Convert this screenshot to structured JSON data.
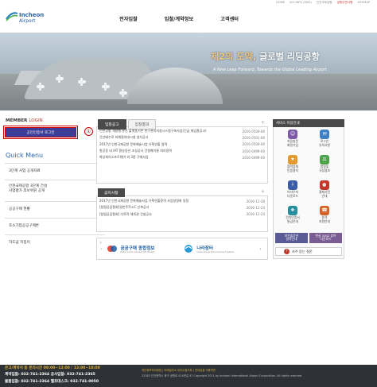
{
  "utility_nav": [
    "HOME",
    "ISO INFO (ENG)",
    "인천국제공항",
    "공항주변사항",
    "SITEMAP"
  ],
  "logo": {
    "name_en": "Incheon",
    "name_en2": "Airport"
  },
  "gnb": [
    "전자입찰",
    "입찰/계약정보",
    "고객센터"
  ],
  "hero": {
    "headline_accent": "제2의 도약,",
    "headline_rest": "글로벌 리딩공항",
    "subline": "A New Leap Forward, Towards the Global Leading Airport"
  },
  "member": {
    "title": "MEMBER",
    "sub": "LOGIN",
    "login_button": "공인인증서 로그인",
    "annotation": "①"
  },
  "quick_menu": {
    "title": "Quick Menu",
    "items": [
      "3단계 사업 공개자료",
      "인천국제공항 3단계 건설\n사업평가 후보위원 공개",
      "공공구매 현황",
      "조소기업공공구매론",
      "하도급 지킴이"
    ]
  },
  "notice_tabs": [
    "입찰공고",
    "입찰결과"
  ],
  "notices": [
    {
      "title": "인천공항 개발행 분산 플랫폼기반 한구관리지침시스템구축사업(긴급 재입찰공고)",
      "date": "2016-0500-00"
    },
    {
      "title": "간선배수로 비해절차대시설 설치공사",
      "date": "2016-0501-00"
    },
    {
      "title": "2017년 인천국제공항 문화예술시업 기획연출 용역",
      "date": "2016-0500-00"
    },
    {
      "title": "항공동 내 IAT 환승동선 조성공사 건설폐기물 처리용역",
      "date": "2016-0499-00"
    },
    {
      "title": "화상회의소프트웨어 외 3종 구매사업",
      "date": "2016-0499-00"
    }
  ],
  "public_tab": "공지사항",
  "public_notices": [
    {
      "title": "2017년 인천국제공항 문화예술사업 기획연출용역 사업설명회 일정",
      "date": "2016-11-28"
    },
    {
      "title": "[청렴공감철회]일반주주소C 신축공사",
      "date": "2016-11-24"
    },
    {
      "title": "[청렴공감철회] 다목적 체육관 건설공사",
      "date": "2016-11-24"
    }
  ],
  "banners": [
    {
      "title": "공공구매 종합정보",
      "sub": "Public e-Procurement Information"
    },
    {
      "title": "나라장터",
      "sub": "Korea Online E-Procurement System"
    }
  ],
  "service": {
    "title": "서비스 이용안내",
    "items": [
      "처음방문\n회원가입",
      "로그인\n유의사항",
      "협력업체\n인증절차",
      "법령및\n규정정보",
      "브라우저\n다운로드",
      "결재사전\n안내",
      "전자인증서\n발급안내",
      "원격\n지원안내"
    ],
    "colors": [
      "#7b5aa6",
      "#3f7fc4",
      "#e29a2e",
      "#4aa34a",
      "#3b5ca8",
      "#c0392b",
      "#2a8f9c",
      "#d4642a"
    ],
    "glyphs": [
      "☺",
      "✉",
      "★",
      "⚖",
      "⇩",
      "⏰",
      "❖",
      "☎"
    ],
    "btn1": "보안솔루션\n설치안내",
    "btn2": "한글 2002 뷰어\n다운로드",
    "faq": "자주 묻는 질문"
  },
  "footer": {
    "hours": "온고/계약서 등 문의시간 09:00~12:00 / 13:00~18:00",
    "contact1": "계약입찰: 032-741-2364  공사입찰: 032-741-2365",
    "contact2": "물품입찰: 032-741-2364  헬프데스크: 032-741-0050",
    "links": "개인정보처리방침   |   이메일주소 무단수집거부   |   전자입찰 이용약관",
    "copyright": "22382 인천광역시 중구 공항로 424번길 47  Copyright 2011 by Incheon International Airport Corporation. All rights reserved."
  }
}
